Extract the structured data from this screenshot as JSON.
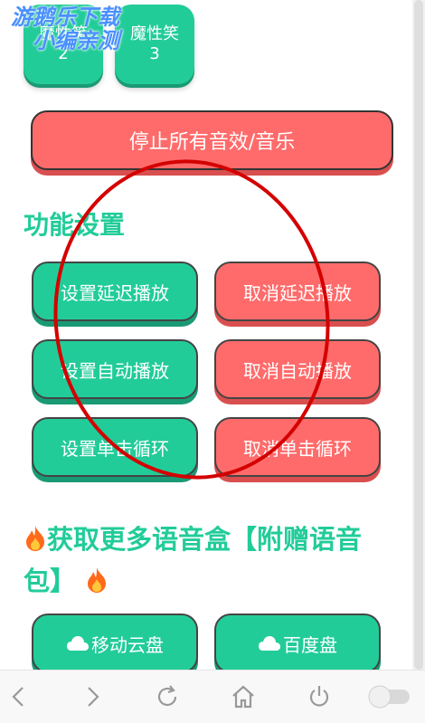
{
  "sound_buttons": [
    {
      "label": "魔性笑",
      "number": "2"
    },
    {
      "label": "魔性笑",
      "number": "3"
    }
  ],
  "stop_all_label": "停止所有音效/音乐",
  "settings_title": "功能设置",
  "function_buttons": [
    {
      "label": "设置延迟播放",
      "style": "green"
    },
    {
      "label": "取消延迟播放",
      "style": "red"
    },
    {
      "label": "设置自动播放",
      "style": "green"
    },
    {
      "label": "取消自动播放",
      "style": "red"
    },
    {
      "label": "设置单击循环",
      "style": "green"
    },
    {
      "label": "取消单击循环",
      "style": "red"
    }
  ],
  "more_title": "获取更多语音盒【附赠语音包】",
  "download_buttons": [
    {
      "label": "移动云盘",
      "icon": "cloud-icon"
    },
    {
      "label": "百度盘",
      "icon": "cloud-icon"
    }
  ],
  "watermark": {
    "line1": "游鹅乐下载",
    "line2": "小编亲测"
  },
  "colors": {
    "accent": "#22cc99",
    "danger": "#ff6b6b",
    "annotation": "#d40000",
    "watermark": "#4a90ff"
  },
  "nav_icons": [
    "back-icon",
    "forward-icon",
    "refresh-icon",
    "home-icon",
    "power-icon",
    "toggle-switch"
  ]
}
